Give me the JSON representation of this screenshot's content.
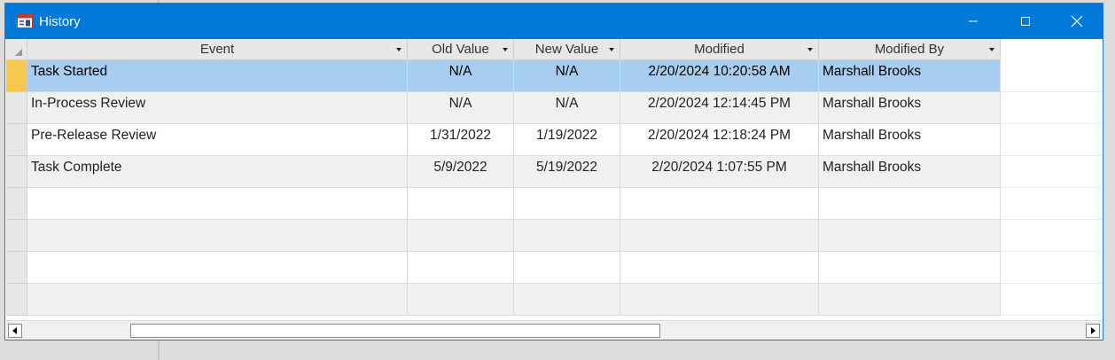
{
  "window": {
    "title": "History",
    "accent_color": "#0078d7",
    "icons": {
      "app": "table-icon",
      "minimize": "minimize-icon",
      "maximize": "maximize-icon",
      "close": "close-icon"
    }
  },
  "grid": {
    "columns": [
      {
        "label": "Event"
      },
      {
        "label": "Old Value"
      },
      {
        "label": "New Value"
      },
      {
        "label": "Modified"
      },
      {
        "label": "Modified By"
      }
    ],
    "rows": [
      {
        "event": "Task Started",
        "old_value": "N/A",
        "new_value": "N/A",
        "modified": "2/20/2024 10:20:58 AM",
        "modified_by": "Marshall Brooks",
        "selected": true
      },
      {
        "event": "In-Process Review",
        "old_value": "N/A",
        "new_value": "N/A",
        "modified": "2/20/2024 12:14:45 PM",
        "modified_by": "Marshall Brooks"
      },
      {
        "event": "Pre-Release Review",
        "old_value": "1/31/2022",
        "new_value": "1/19/2022",
        "modified": "2/20/2024 12:18:24 PM",
        "modified_by": "Marshall Brooks"
      },
      {
        "event": "Task Complete",
        "old_value": "5/9/2022",
        "new_value": "5/19/2022",
        "modified": "2/20/2024 1:07:55 PM",
        "modified_by": "Marshall Brooks"
      }
    ],
    "empty_rows": 4,
    "selection_color": "#a7cdf0",
    "current_record_color": "#f6c84d"
  },
  "scrollbar": {
    "icons": {
      "left": "arrow-left-icon",
      "right": "arrow-right-icon"
    }
  }
}
